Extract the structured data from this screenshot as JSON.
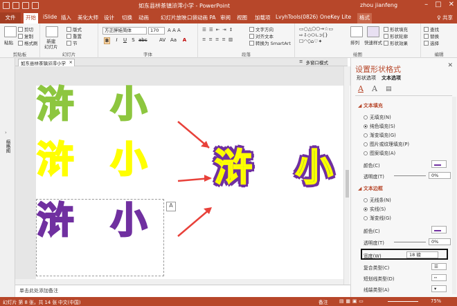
{
  "window": {
    "title": "如东县栟茶镇浒澪小学 - PowerPoint",
    "user": "zhou jianfeng",
    "controls": [
      "–",
      "□",
      "✕"
    ]
  },
  "tabs": [
    "文件",
    "开始",
    "iSlide",
    "插入",
    "美化大师",
    "设计",
    "切换",
    "动画",
    "幻灯片放映",
    "口袋动画 PA",
    "幻灯片放映",
    "审阅",
    "视图",
    "加载项",
    "LvyhTools(0826)",
    "OneKey Lite",
    "格式"
  ],
  "share": "♀ 共享",
  "ribbon": {
    "paste": "粘贴",
    "cut": "剪切",
    "copy": "复制",
    "format_painter": "格式刷",
    "new_slide": "新建\n幻灯片",
    "layout": "版式",
    "reset": "重置",
    "section": "节",
    "font_name": "方正胖娃简体",
    "font_size": "170",
    "text_direction": "文字方向",
    "align_text": "对齐文本",
    "smartart": "转换为 SmartArt",
    "arrange": "排列",
    "quick_styles": "快速样式",
    "shape_fill": "形状填充",
    "shape_outline": "形状轮廓",
    "shape_effects": "形状效果",
    "find": "查找",
    "replace": "替换",
    "select": "选择",
    "groups": [
      "剪贴板",
      "幻灯片",
      "字体",
      "段落",
      "绘图",
      "编辑"
    ]
  },
  "thumbnail_label": "缩略图",
  "doc_tab": "如东县栟茶镇浒澪小学",
  "doc_tools": [
    "≡",
    "多窗口模式"
  ],
  "slide": {
    "words": [
      {
        "text": "浒 小",
        "fill": "#8dc63f",
        "outline": "#8dc63f"
      },
      {
        "text": "浒 小",
        "fill": "#ffff00",
        "outline": "#ffff00"
      },
      {
        "text": "浒 小",
        "fill": "#7030a0",
        "outline": "#7030a0"
      },
      {
        "text": "浒 小",
        "fill": "#8dc63f",
        "outline": "#ffff00"
      }
    ],
    "outer_stroke": "#7030a0"
  },
  "notes_placeholder": "单击此处添加备注",
  "pane": {
    "title": "设置形状格式",
    "close": "✕",
    "tabs": [
      "形状选项",
      "文本选项"
    ],
    "text_fill_header": "文本填充",
    "fill_options": [
      "无填充(N)",
      "纯色填充(S)",
      "渐变填充(G)",
      "图片或纹理填充(P)",
      "图案填充(A)"
    ],
    "fill_selected": 1,
    "color_label": "颜色(C)",
    "transparency_label": "透明度(T)",
    "fill_transparency": "0%",
    "text_outline_header": "文本边框",
    "outline_options": [
      "无线条(N)",
      "实线(S)",
      "渐变线(G)"
    ],
    "outline_selected": 1,
    "outline_transparency": "0%",
    "width_label": "宽度(W)",
    "width_value": "18 磅",
    "compound_label": "复合类型(C)",
    "dash_label": "短划线类型(D)",
    "cap_label": "线端类型(A)",
    "fill_color": "#7030a0",
    "outline_color": "#7030a0"
  },
  "status": {
    "slide_info": "幻灯片 第 8 张，共 14 张",
    "lang": "中文(中国)",
    "notes": "备注",
    "zoom": "75%"
  },
  "colors": {
    "accent": "#b7472a",
    "arrow": "#e8413a"
  }
}
